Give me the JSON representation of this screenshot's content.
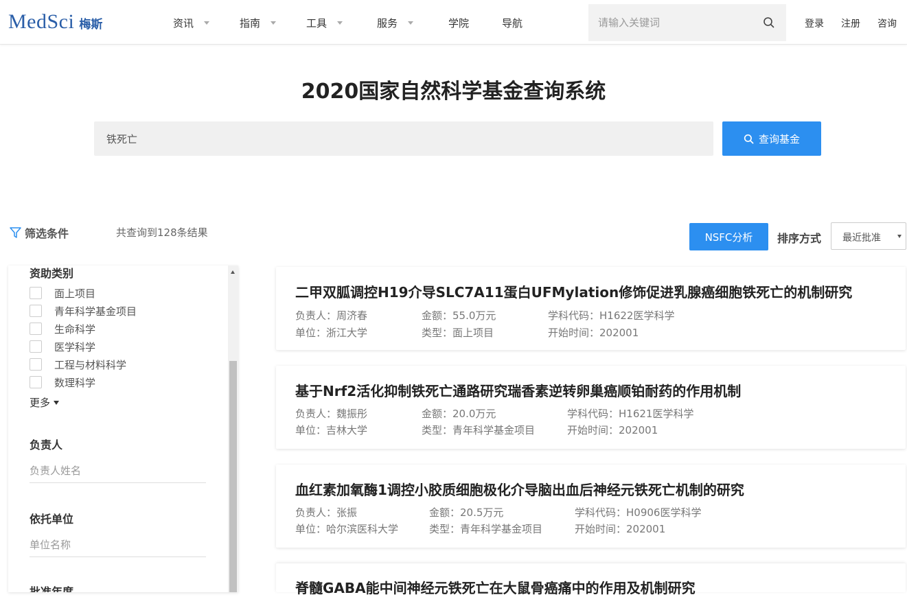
{
  "header": {
    "logo_en": "MedSci",
    "logo_cn": "梅斯",
    "nav": [
      {
        "label": "资讯"
      },
      {
        "label": "指南"
      },
      {
        "label": "工具"
      },
      {
        "label": "服务"
      },
      {
        "label": "学院"
      },
      {
        "label": "导航"
      }
    ],
    "search_placeholder": "请输入关键词",
    "login": "登录",
    "register": "注册",
    "consult": "咨询"
  },
  "page_title": "2020国家自然科学基金查询系统",
  "main_search": {
    "value": "铁死亡",
    "button": "查询基金"
  },
  "toolbar": {
    "filter_title": "筛选条件",
    "result_count": "共查询到128条结果",
    "nsfc_button": "NSFC分析",
    "sort_label": "排序方式",
    "sort_value": "最近批准"
  },
  "sidebar": {
    "funding_heading": "资助类别",
    "categories": [
      {
        "label": "面上项目",
        "checked": false
      },
      {
        "label": "青年科学基金项目",
        "checked": false
      },
      {
        "label": "生命科学",
        "checked": false
      },
      {
        "label": "医学科学",
        "checked": false
      },
      {
        "label": "工程与材料科学",
        "checked": false
      },
      {
        "label": "数理科学",
        "checked": false
      }
    ],
    "more": "更多",
    "pi_heading": "负责人",
    "pi_placeholder": "负责人姓名",
    "org_heading": "依托单位",
    "org_placeholder": "单位名称",
    "year_heading": "批准年度"
  },
  "results": [
    {
      "title": "二甲双胍调控H19介导SLC7A11蛋白UFMylation修饰促进乳腺癌细胞铁死亡的机制研究",
      "pi": "负责人：周济春",
      "amount": "金额：55.0万元",
      "code": "学科代码：H1622医学科学",
      "org": "单位：浙江大学",
      "type": "类型：面上项目",
      "start": "开始时间：202001"
    },
    {
      "title": "基于Nrf2活化抑制铁死亡通路研究瑞香素逆转卵巢癌顺铂耐药的作用机制",
      "pi": "负责人：魏振彤",
      "amount": "金额：20.0万元",
      "code": "学科代码：H1621医学科学",
      "org": "单位：吉林大学",
      "type": "类型：青年科学基金项目",
      "start": "开始时间：202001"
    },
    {
      "title": "血红素加氧酶1调控小胶质细胞极化介导脑出血后神经元铁死亡机制的研究",
      "pi": "负责人：张振",
      "amount": "金额：20.5万元",
      "code": "学科代码：H0906医学科学",
      "org": "单位：哈尔滨医科大学",
      "type": "类型：青年科学基金项目",
      "start": "开始时间：202001"
    },
    {
      "title": "脊髓GABA能中间神经元铁死亡在大鼠骨癌痛中的作用及机制研究"
    }
  ],
  "colors": {
    "brand": "#2a5ea8",
    "primary_button": "#2c8ff0"
  }
}
